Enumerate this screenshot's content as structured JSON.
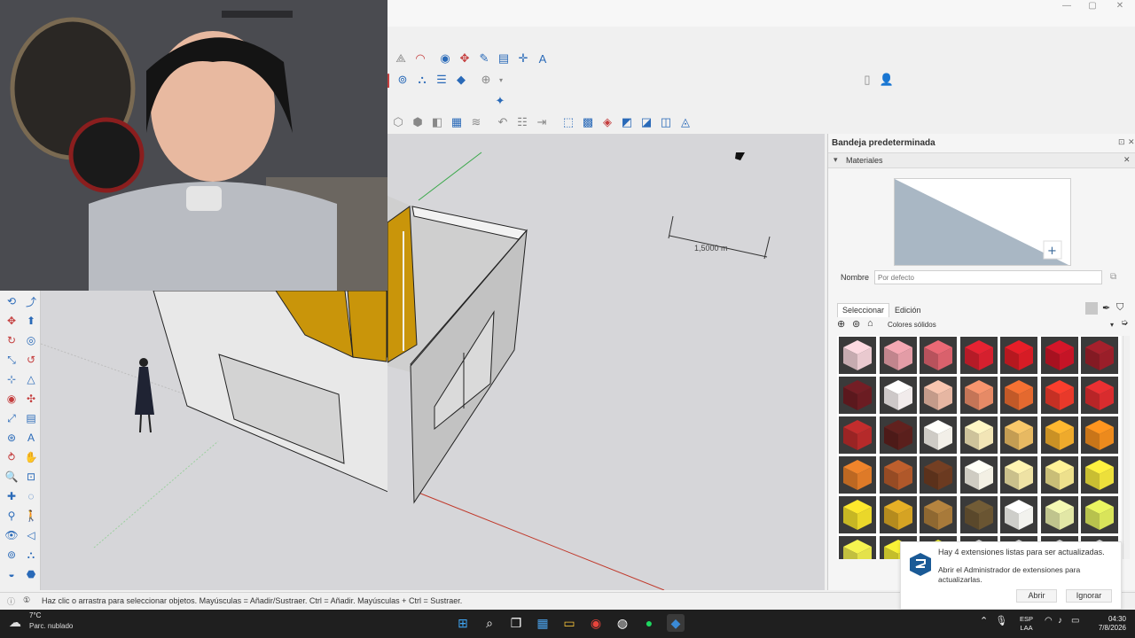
{
  "window": {
    "minimize": "—",
    "maximize": "▢",
    "close": "✕"
  },
  "viewport": {
    "dimension_label": "1,5000 m"
  },
  "tray": {
    "title": "Bandeja predeterminada",
    "panel_title": "Materiales",
    "name_label": "Nombre",
    "name_placeholder": "Por defecto",
    "tabs": [
      "Seleccionar",
      "Edición"
    ],
    "category": "Colores sólidos",
    "swatch_colors": [
      "#e9c9cf",
      "#e39ca6",
      "#d9616c",
      "#d5202e",
      "#d61c25",
      "#c51426",
      "#9a1e29",
      "#6b1c22",
      "#f1ebeb",
      "#e6b6a2",
      "#e68a66",
      "#e4692f",
      "#e8392a",
      "#d92c2e",
      "#b52a2a",
      "#5a1f1c",
      "#f2efe8",
      "#f2e5b6",
      "#e7b962",
      "#eeaa2c",
      "#ec8a1d",
      "#de7a28",
      "#b0582a",
      "#6b3a20",
      "#f3f0e4",
      "#eee2a4",
      "#ede08c",
      "#ecdf3b",
      "#ead72a",
      "#d5a323",
      "#a87a3a",
      "#6a5532",
      "#f2f2ee",
      "#e2e7a6",
      "#d9e45a",
      "#e4e24a",
      "#e6df33",
      "#dede2e",
      "#c7c7c7",
      "#c7c7c7",
      "#c7c7c7",
      "#c7c7c7"
    ]
  },
  "status": {
    "text": "Haz clic o arrastra para seleccionar objetos. Mayúsculas = Añadir/Sustraer. Ctrl = Añadir. Mayúsculas + Ctrl = Sustraer."
  },
  "notification": {
    "line1": "Hay 4 extensiones listas para ser actualizadas.",
    "line2": "Abrir el Administrador de extensiones para actualizarlas.",
    "open": "Abrir",
    "ignore": "Ignorar"
  },
  "taskbar": {
    "temperature": "7°C",
    "weather": "Parc. nublado",
    "lang_line1": "ESP",
    "lang_line2": "LAA",
    "time": "04:30",
    "date": "7/8/2026"
  },
  "colors": {
    "accent": "#2a6ab8",
    "axis_red": "#c0392b",
    "axis_green": "#3aa84a",
    "wall": "#e8e8e8",
    "door": "#c9950a"
  }
}
